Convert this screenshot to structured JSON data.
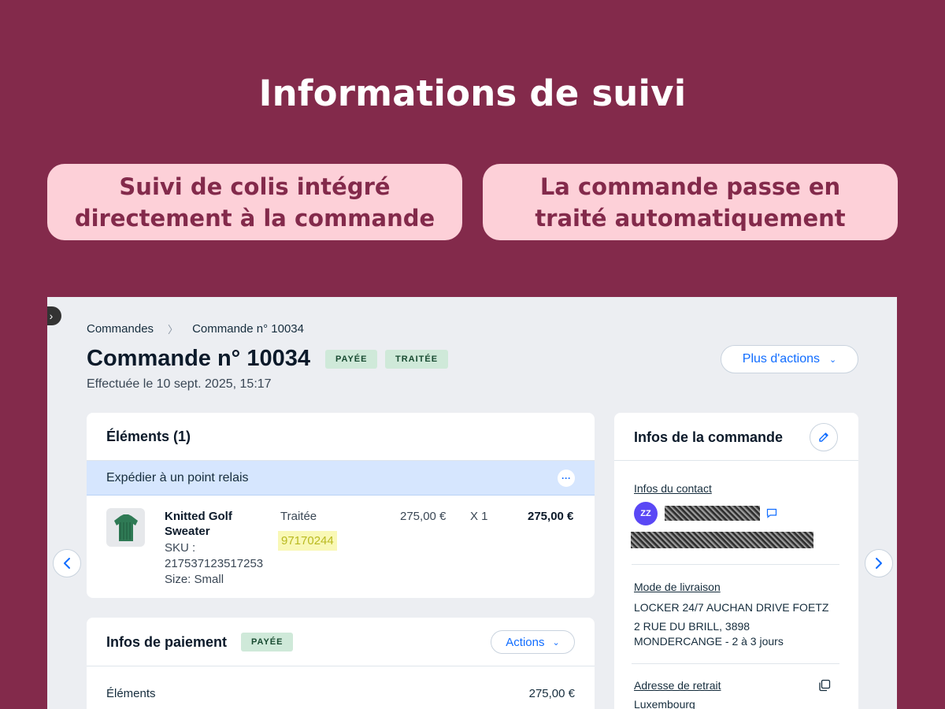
{
  "hero": {
    "title": "Informations de suivi",
    "pill_left": "Suivi de colis intégré directement à la commande",
    "pill_right": "La commande passe en traité automatiquement"
  },
  "breadcrumb": {
    "parent": "Commandes",
    "current": "Commande n° 10034"
  },
  "order": {
    "title": "Commande n° 10034",
    "badge_paid": "PAYÉE",
    "badge_processed": "TRAITÉE",
    "date": "Effectuée le 10 sept. 2025, 15:17",
    "more_actions": "Plus d'actions"
  },
  "items_card": {
    "title": "Éléments (1)",
    "relay_label": "Expédier à un point relais",
    "item": {
      "name": "Knitted Golf Sweater",
      "sku": "SKU : 217537123517253",
      "size": "Size: Small",
      "status": "Traitée",
      "tracking_number": "97170244",
      "unit_price": "275,00 €",
      "quantity": "X 1",
      "total": "275,00 €"
    }
  },
  "payment_card": {
    "title": "Infos de paiement",
    "badge": "PAYÉE",
    "actions": "Actions",
    "row_label": "Éléments",
    "row_value": "275,00 €"
  },
  "info_card": {
    "title": "Infos de la commande",
    "contact_label": "Infos du contact",
    "avatar_initials": "ZZ",
    "delivery_label": "Mode de livraison",
    "delivery_line1": "LOCKER 24/7 AUCHAN DRIVE FOETZ",
    "delivery_line2": "2 RUE DU BRILL, 3898",
    "delivery_line3": "MONDERCANGE - 2 à 3 jours",
    "pickup_label": "Adresse de retrait",
    "pickup_country": "Luxembourg"
  },
  "colors": {
    "background": "#832a4b",
    "pill": "#fdd0d8",
    "accent": "#116dff",
    "badge": "#cfe9d9",
    "relay_bar": "#d6e6fe",
    "tracking_highlight": "#f9f8b6"
  },
  "icons": [
    "chevron-right-icon",
    "chevron-down-icon",
    "more-dots-icon",
    "sweater-thumbnail",
    "pencil-icon",
    "chat-icon",
    "copy-icon",
    "arrow-left-icon",
    "arrow-right-icon"
  ]
}
